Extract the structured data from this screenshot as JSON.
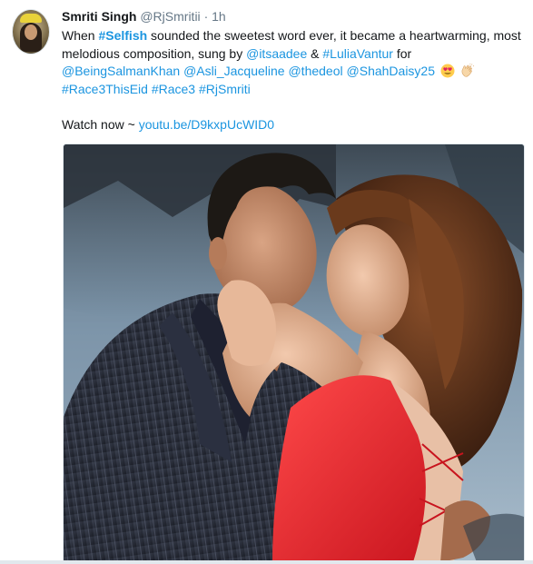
{
  "tweet": {
    "author_name": "Smriti Singh",
    "author_handle": "@RjSmritii",
    "separator": "·",
    "time": "1h",
    "text": {
      "line1_a": "When ",
      "line1_hashtag": "#Selfish",
      "line1_b": " sounded the sweetest word ever, it became a heartwarming, most",
      "line2_a": "melodious composition, sung by ",
      "line2_m1": "@itsaadee",
      "line2_b": " & ",
      "line2_h1": "#LuliaVantur",
      "line2_c": " for",
      "line3_m1": "@BeingSalmanKhan",
      "line3_m2": "@Asli_Jacqueline",
      "line3_m3": "@thedeol",
      "line3_m4": "@ShahDaisy25",
      "line4_h1": "#Race3ThisEid",
      "line4_h2": "#Race3",
      "line4_h3": "#RjSmriti",
      "watch_label": "Watch now ~ ",
      "watch_link": "youtu.be/D9kxpUcWID0"
    },
    "emoji": [
      "heart-eyes-emoji",
      "clapping-hands-emoji"
    ]
  },
  "colors": {
    "link": "#1b95e0",
    "text": "#14171a",
    "muted": "#657786"
  }
}
